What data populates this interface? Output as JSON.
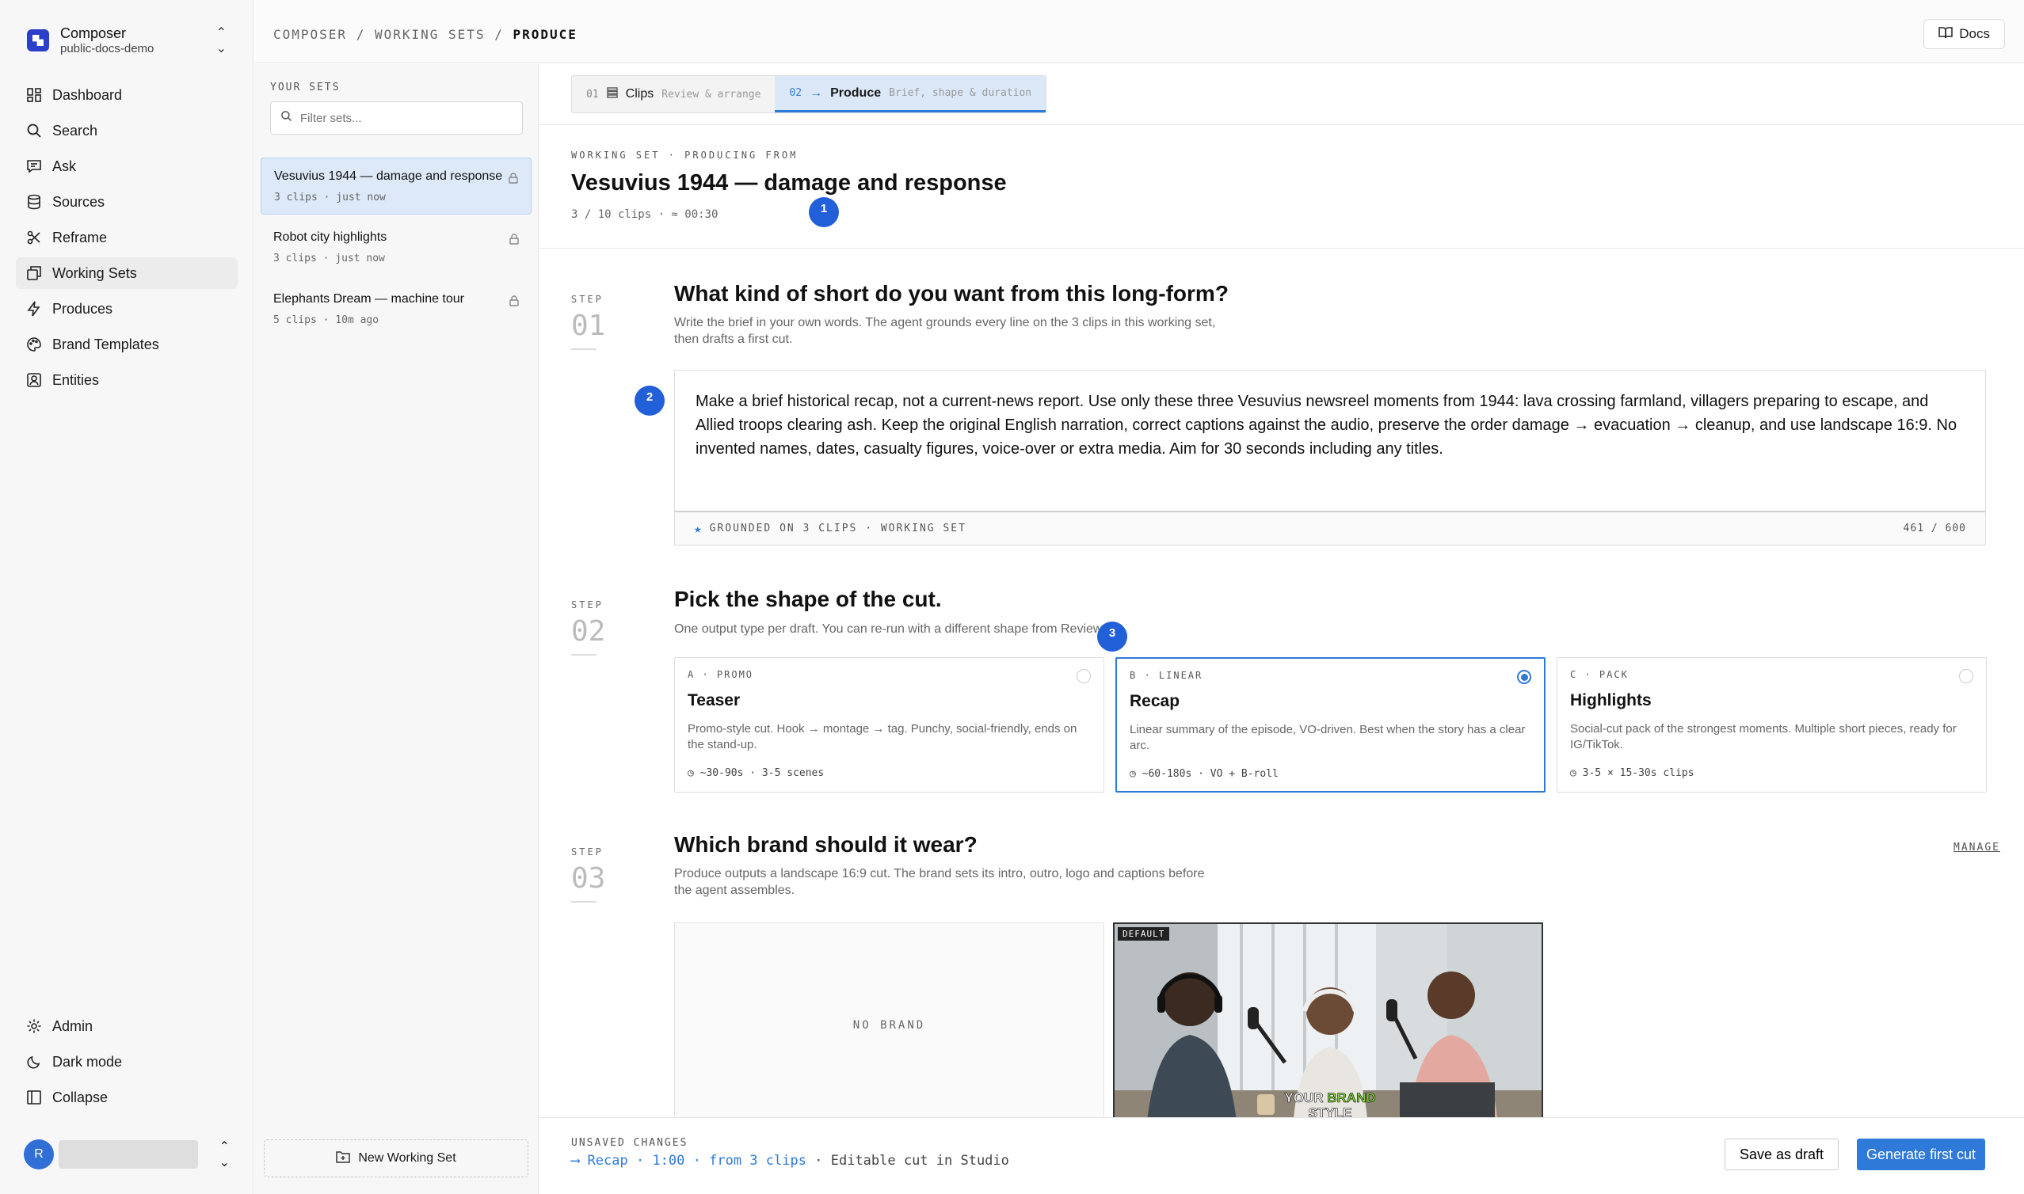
{
  "workspace": {
    "name": "Composer",
    "sub": "public-docs-demo"
  },
  "nav": {
    "items": [
      {
        "label": "Dashboard",
        "icon": "dashboard-icon"
      },
      {
        "label": "Search",
        "icon": "search-icon"
      },
      {
        "label": "Ask",
        "icon": "chat-icon"
      },
      {
        "label": "Sources",
        "icon": "database-icon"
      },
      {
        "label": "Reframe",
        "icon": "scissors-icon"
      },
      {
        "label": "Working Sets",
        "icon": "layers-icon"
      },
      {
        "label": "Produces",
        "icon": "bolt-icon"
      },
      {
        "label": "Brand Templates",
        "icon": "palette-icon"
      },
      {
        "label": "Entities",
        "icon": "contact-icon"
      }
    ],
    "active": "Working Sets",
    "bottom": [
      {
        "label": "Admin",
        "icon": "gear-icon"
      },
      {
        "label": "Dark mode",
        "icon": "moon-icon"
      },
      {
        "label": "Collapse",
        "icon": "collapse-icon"
      }
    ],
    "user_initial": "R"
  },
  "breadcrumb": {
    "part1": "COMPOSER",
    "sep": "/",
    "part2": "WORKING SETS",
    "current": "PRODUCE"
  },
  "docs_label": "Docs",
  "sets": {
    "label": "YOUR SETS",
    "filter_placeholder": "Filter sets...",
    "items": [
      {
        "name": "Vesuvius 1944 — damage and response",
        "meta": "3 clips · just now"
      },
      {
        "name": "Robot city highlights",
        "meta": "3 clips · just now"
      },
      {
        "name": "Elephants Dream — machine tour",
        "meta": "5 clips · 10m ago"
      }
    ],
    "new_label": "New Working Set"
  },
  "tabs": [
    {
      "num": "01",
      "label": "Clips",
      "sub": "Review & arrange"
    },
    {
      "num": "02",
      "label": "Produce",
      "sub": "Brief, shape & duration"
    }
  ],
  "header": {
    "label": "WORKING SET · PRODUCING FROM",
    "title": "Vesuvius 1944 — damage and response",
    "meta": "3 / 10 clips  ·  ≈ 00:30"
  },
  "markers": [
    "1",
    "2",
    "3"
  ],
  "step_label": "STEP",
  "step1": {
    "num": "01",
    "title": "What kind of short do you want from this long-form?",
    "desc1": "Write the brief in your own words. The agent grounds every line on the 3 clips in this working set,",
    "desc2": "then drafts a first cut.",
    "brief": "Make a brief historical recap, not a current-news report. Use only these three Vesuvius newsreel moments from 1944: lava crossing farmland, villagers preparing to escape, and Allied troops clearing ash. Keep the original English narration, correct captions against the audio, preserve the order damage → evacuation → cleanup, and use landscape 16:9. No invented names, dates, casualty figures, voice-over or extra media. Aim for 30 seconds including any titles.",
    "grounded": "GROUNDED ON 3 CLIPS · WORKING SET",
    "count": "461 / 600"
  },
  "step2": {
    "num": "02",
    "title": "Pick the shape of the cut.",
    "desc": "One output type per draft. You can re-run with a different shape from Review.",
    "cards": [
      {
        "kicker": "A · PROMO",
        "title": "Teaser",
        "desc": "Promo-style cut. Hook → montage → tag. Punchy, social-friendly, ends on the stand-up.",
        "foot": "~30-90s · 3-5 scenes"
      },
      {
        "kicker": "B · LINEAR",
        "title": "Recap",
        "desc": "Linear summary of the episode, VO-driven. Best when the story has a clear arc.",
        "foot": "~60-180s · VO + B-roll"
      },
      {
        "kicker": "C · PACK",
        "title": "Highlights",
        "desc": "Social-cut pack of the strongest moments. Multiple short pieces, ready for IG/TikTok.",
        "foot": "3-5 × 15-30s clips"
      }
    ],
    "selected": 1
  },
  "step3": {
    "num": "03",
    "title": "Which brand should it wear?",
    "desc1": "Produce outputs a landscape 16:9 cut. The brand sets its intro, outro, logo and captions before",
    "desc2": "the agent assembles.",
    "manage": "MANAGE",
    "no_brand": "NO BRAND",
    "default_tag": "DEFAULT",
    "overlay1": "YOUR",
    "overlay_accent": "BRAND",
    "overlay2": "STYLE"
  },
  "footer": {
    "status": "UNSAVED CHANGES",
    "arrow": "⟶",
    "shape": "Recap",
    "duration": "1:00",
    "source": "from 3 clips",
    "note": "Editable cut in Studio",
    "dot": "·",
    "save": "Save as draft",
    "generate": "Generate first cut"
  },
  "colors": {
    "accent": "#2f7ad9",
    "marker": "#2260d9",
    "overlay_accent": "#7fd63a"
  }
}
